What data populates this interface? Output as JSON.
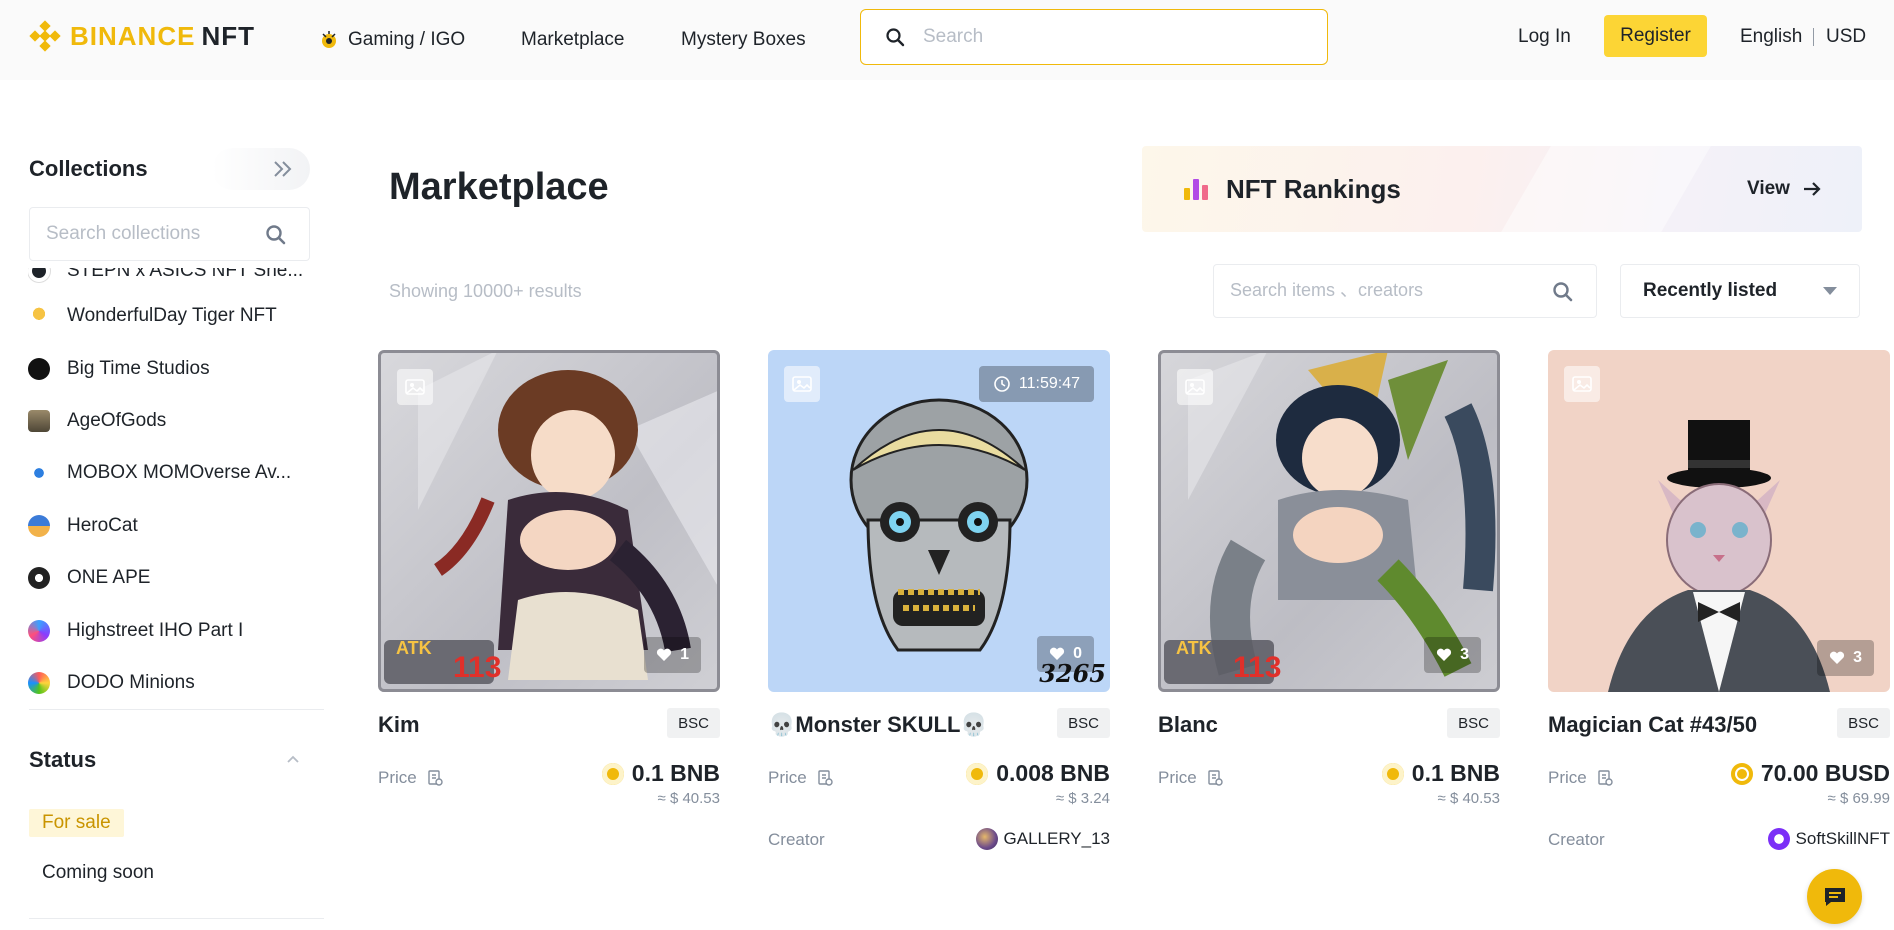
{
  "header": {
    "logo_text": "BINANCE",
    "logo_suffix": "NFT",
    "nav": [
      {
        "label": "Gaming / IGO"
      },
      {
        "label": "Marketplace"
      },
      {
        "label": "Mystery Boxes"
      }
    ],
    "search_placeholder": "Search",
    "login_label": "Log In",
    "register_label": "Register",
    "language": "English",
    "currency": "USD",
    "accent_color": "#F0B90B"
  },
  "sidebar": {
    "title": "Collections",
    "search_placeholder": "Search collections",
    "collections": [
      {
        "label": "STEPN x ASICS NFT Sne..."
      },
      {
        "label": "WonderfulDay Tiger NFT"
      },
      {
        "label": "Big Time Studios"
      },
      {
        "label": "AgeOfGods"
      },
      {
        "label": "MOBOX MOMOverse Av..."
      },
      {
        "label": "HeroCat"
      },
      {
        "label": "ONE APE"
      },
      {
        "label": "Highstreet IHO Part I"
      },
      {
        "label": "DODO Minions"
      }
    ],
    "status_title": "Status",
    "status_options": [
      {
        "label": "For sale",
        "selected": true
      },
      {
        "label": "Coming soon",
        "selected": false
      }
    ]
  },
  "main": {
    "title": "Marketplace",
    "rankings": {
      "title": "NFT Rankings",
      "view_label": "View"
    },
    "results_text": "Showing 10000+ results",
    "item_search_placeholder": "Search items 、creators",
    "sort_label": "Recently listed",
    "cards": [
      {
        "name": "Kim",
        "chain": "BSC",
        "price_label": "Price",
        "price": "0.1 BNB",
        "usd": "≈ $ 40.53",
        "likes": "1",
        "overlay_text": "113"
      },
      {
        "name": "💀Monster SKULL💀",
        "chain": "BSC",
        "price_label": "Price",
        "price": "0.008 BNB",
        "usd": "≈ $ 3.24",
        "likes": "0",
        "timer": "11:59:47",
        "creator_label": "Creator",
        "creator": "GALLERY_13",
        "overlay_text": "3265"
      },
      {
        "name": "Blanc",
        "chain": "BSC",
        "price_label": "Price",
        "price": "0.1 BNB",
        "usd": "≈ $ 40.53",
        "likes": "3",
        "overlay_text": "113"
      },
      {
        "name": "Magician Cat #43/50",
        "chain": "BSC",
        "price_label": "Price",
        "price": "70.00 BUSD",
        "usd": "≈ $ 69.99",
        "likes": "3",
        "creator_label": "Creator",
        "creator": "SoftSkillNFT"
      }
    ]
  }
}
